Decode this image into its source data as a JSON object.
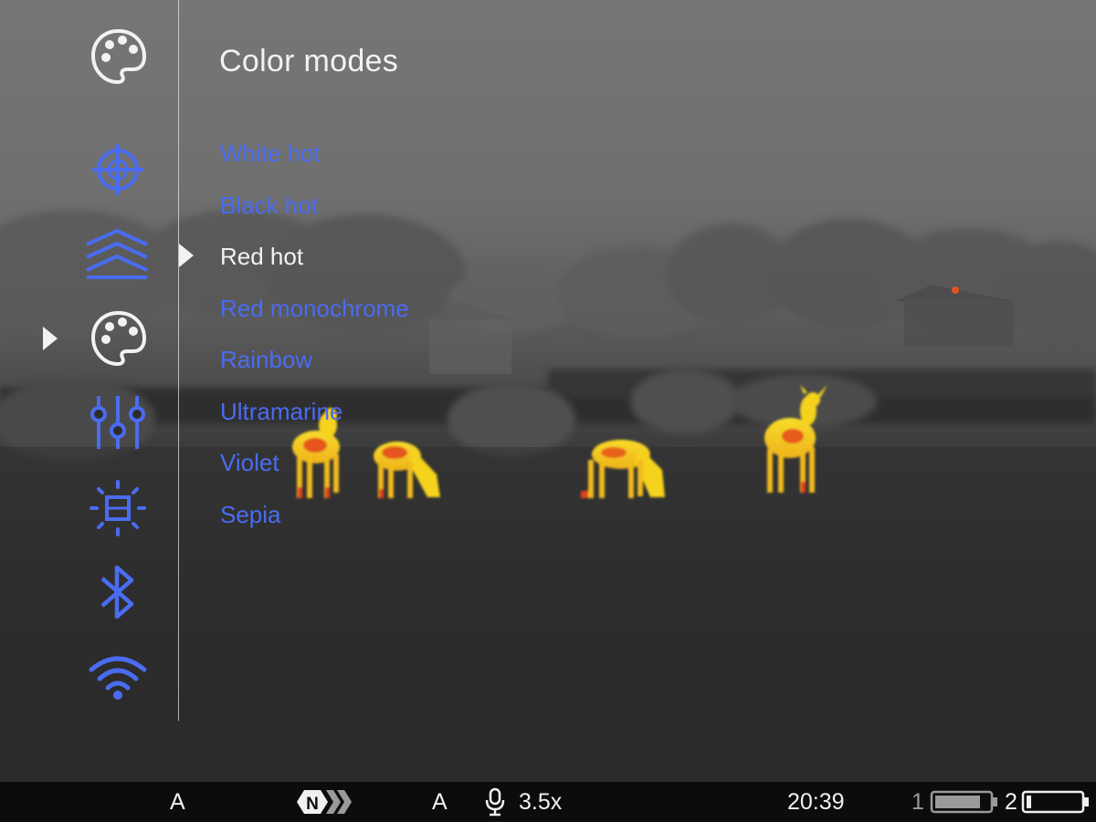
{
  "menu": {
    "title": "Color modes",
    "items": [
      {
        "label": "White hot"
      },
      {
        "label": "Black hot"
      },
      {
        "label": "Red hot"
      },
      {
        "label": "Red monochrome"
      },
      {
        "label": "Rainbow"
      },
      {
        "label": "Ultramarine"
      },
      {
        "label": "Violet"
      },
      {
        "label": "Sepia"
      }
    ],
    "selected_index": 2
  },
  "sidebar": {
    "top_icon": "palette-icon",
    "items": [
      {
        "icon": "crosshair-icon"
      },
      {
        "icon": "layers-icon"
      },
      {
        "icon": "palette-icon",
        "selected": true
      },
      {
        "icon": "sliders-icon"
      },
      {
        "icon": "brightness-icon"
      },
      {
        "icon": "bluetooth-icon"
      },
      {
        "icon": "wifi-icon"
      }
    ]
  },
  "statusbar": {
    "mode_a1": "A",
    "nav_icon_letter": "N",
    "mode_a2": "A",
    "zoom": "3.5x",
    "time": "20:39",
    "battery1_label": "1",
    "battery1_level": 0.85,
    "battery2_label": "2",
    "battery2_level": 0.08
  },
  "colors": {
    "accent_blue": "#4a6cf0",
    "selected_white": "#f2f2f2",
    "statusbar_bg": "#0c0c0c",
    "thermal_hot_yellow": "#f5d21f",
    "thermal_hot_red": "#e2401a"
  }
}
